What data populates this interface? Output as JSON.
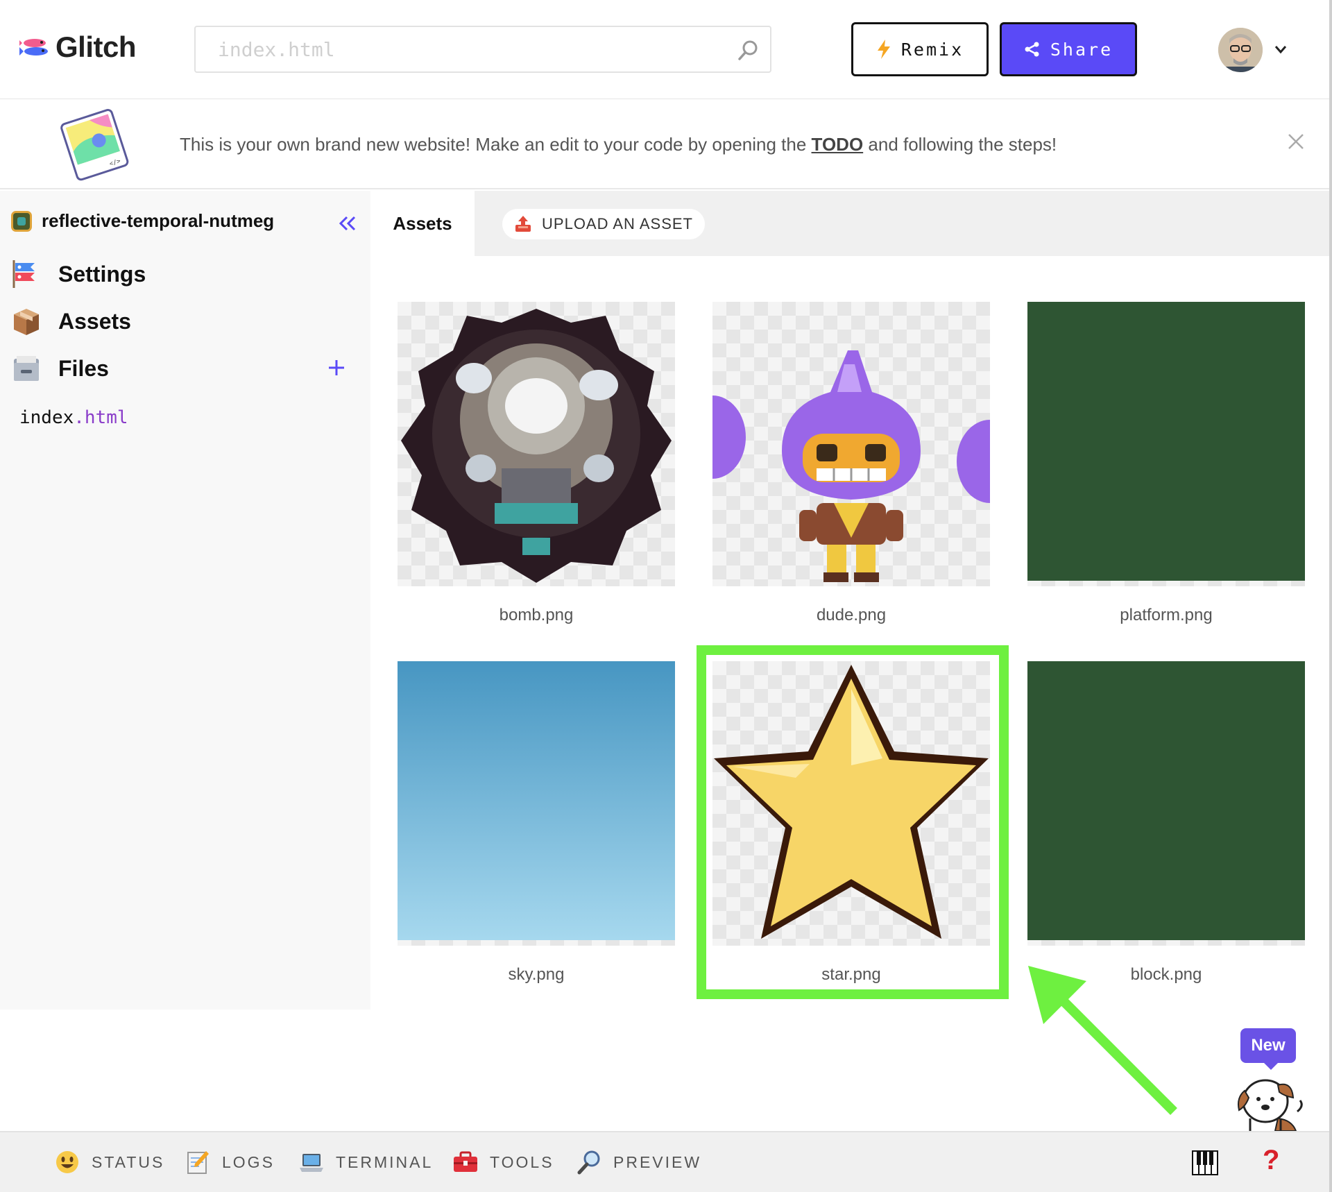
{
  "header": {
    "brand": "Glitch",
    "search_placeholder": "index.html",
    "remix_label": "Remix",
    "share_label": "Share"
  },
  "banner": {
    "text_before": "This is your own brand new website! Make an edit to your code by opening the ",
    "link_text": "TODO",
    "text_after": " and following the steps!"
  },
  "sidebar": {
    "project_name": "reflective-temporal-nutmeg",
    "items": [
      {
        "label": "Settings",
        "icon": "koinobori-icon"
      },
      {
        "label": "Assets",
        "icon": "package-icon"
      },
      {
        "label": "Files",
        "icon": "file-cabinet-icon"
      }
    ],
    "files": [
      {
        "name": "index",
        "ext": ".html"
      }
    ]
  },
  "main": {
    "tab_label": "Assets",
    "upload_label": "UPLOAD AN ASSET",
    "assets": [
      {
        "name": "bomb.png"
      },
      {
        "name": "dude.png"
      },
      {
        "name": "platform.png"
      },
      {
        "name": "sky.png"
      },
      {
        "name": "star.png",
        "highlighted": true
      },
      {
        "name": "block.png"
      }
    ],
    "new_badge": "New"
  },
  "bottombar": {
    "status": "STATUS",
    "logs": "LOGS",
    "terminal": "TERMINAL",
    "tools": "TOOLS",
    "preview": "PREVIEW",
    "help": "?"
  },
  "colors": {
    "accent": "#5a4af7",
    "highlight": "#6ef040",
    "platform": "#2e5533",
    "sky_top": "#4796c2",
    "sky_bottom": "#a6d8ee",
    "star": "#f7d567"
  }
}
